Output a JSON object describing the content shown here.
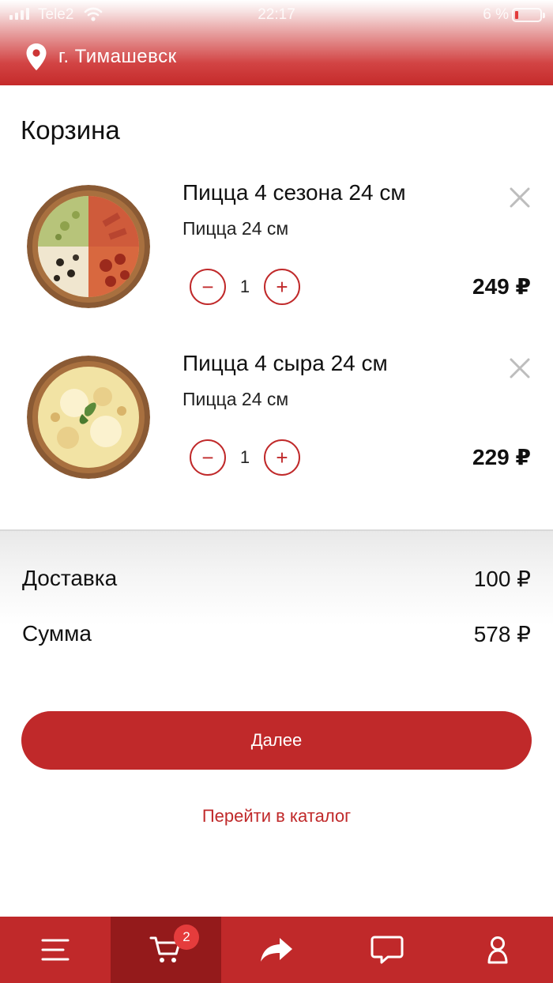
{
  "status_bar": {
    "carrier": "Tele2",
    "time": "22:17",
    "battery": "6 %",
    "battery_level": 0.06
  },
  "header": {
    "city": "г. Тимашевск"
  },
  "page_title": "Корзина",
  "cart": {
    "items": [
      {
        "name": "Пицца 4 сезона 24 см",
        "description": "Пицца 24 см",
        "quantity": "1",
        "price": "249 ₽",
        "decrement": "−",
        "increment": "+"
      },
      {
        "name": "Пицца 4 сыра 24 см",
        "description": "Пицца 24 см",
        "quantity": "1",
        "price": "229 ₽",
        "decrement": "−",
        "increment": "+"
      }
    ]
  },
  "summary": {
    "delivery_label": "Доставка",
    "delivery_value": "100 ₽",
    "total_label": "Сумма",
    "total_value": "578 ₽"
  },
  "actions": {
    "next_label": "Далее",
    "catalog_link": "Перейти в каталог"
  },
  "tab_bar": {
    "cart_badge": "2",
    "tabs": [
      {
        "icon": "menu-icon"
      },
      {
        "icon": "cart-icon",
        "active": true
      },
      {
        "icon": "share-icon"
      },
      {
        "icon": "chat-icon"
      },
      {
        "icon": "profile-icon"
      }
    ]
  },
  "colors": {
    "accent": "#c0292a",
    "accent_dark": "#941a1b",
    "badge": "#e53c3c"
  }
}
